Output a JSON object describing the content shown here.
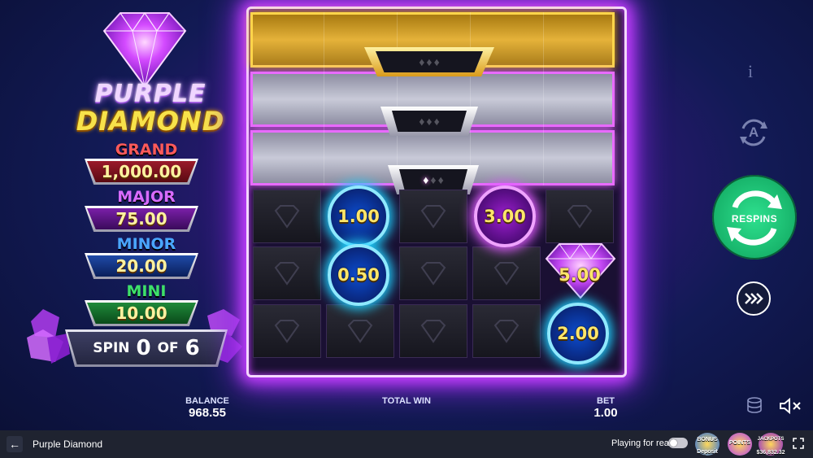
{
  "game": {
    "title_line1": "PURPLE",
    "title_line2": "DIAMOND"
  },
  "jackpots": [
    {
      "label": "GRAND",
      "value": "1,000.00",
      "label_color": "#ff5a5a",
      "box_color": "#7a0f1a"
    },
    {
      "label": "MAJOR",
      "value": "75.00",
      "label_color": "#d86bff",
      "box_color": "#4f0f7a"
    },
    {
      "label": "MINOR",
      "value": "20.00",
      "label_color": "#4aa6ff",
      "box_color": "#0f2f7a"
    },
    {
      "label": "MINI",
      "value": "10.00",
      "label_color": "#3ee06a",
      "box_color": "#0f5a2a"
    }
  ],
  "spin_counter": {
    "spin_label": "SPIN",
    "current": "0",
    "of_label": "OF",
    "total": "6"
  },
  "coins": {
    "c1": "1.00",
    "c2": "3.00",
    "c3": "0.50",
    "c4": "5.00",
    "c5": "2.00"
  },
  "controls": {
    "info": "i",
    "auto": "A",
    "respin_label": "RESPINS"
  },
  "bottom": {
    "balance_label": "BALANCE",
    "balance_value": "968.55",
    "total_win_label": "TOTAL WIN",
    "total_win_value": "",
    "bet_label": "BET",
    "bet_value": "1.00"
  },
  "footer": {
    "game_name": "Purple Diamond",
    "playing_for_real": "Playing for real",
    "badge1_title": "BONUS",
    "badge1_sub": "Deposit",
    "badge2_title": "POINTS",
    "badge3_title": "JACKPOTS",
    "badge3_sub": "$36,832.32"
  },
  "colors": {
    "accent_purple": "#c840ff",
    "respin_green": "#17b36a",
    "coin_blue_ring": "#8fe9ff",
    "coin_pink_ring": "#f0a3ff"
  }
}
